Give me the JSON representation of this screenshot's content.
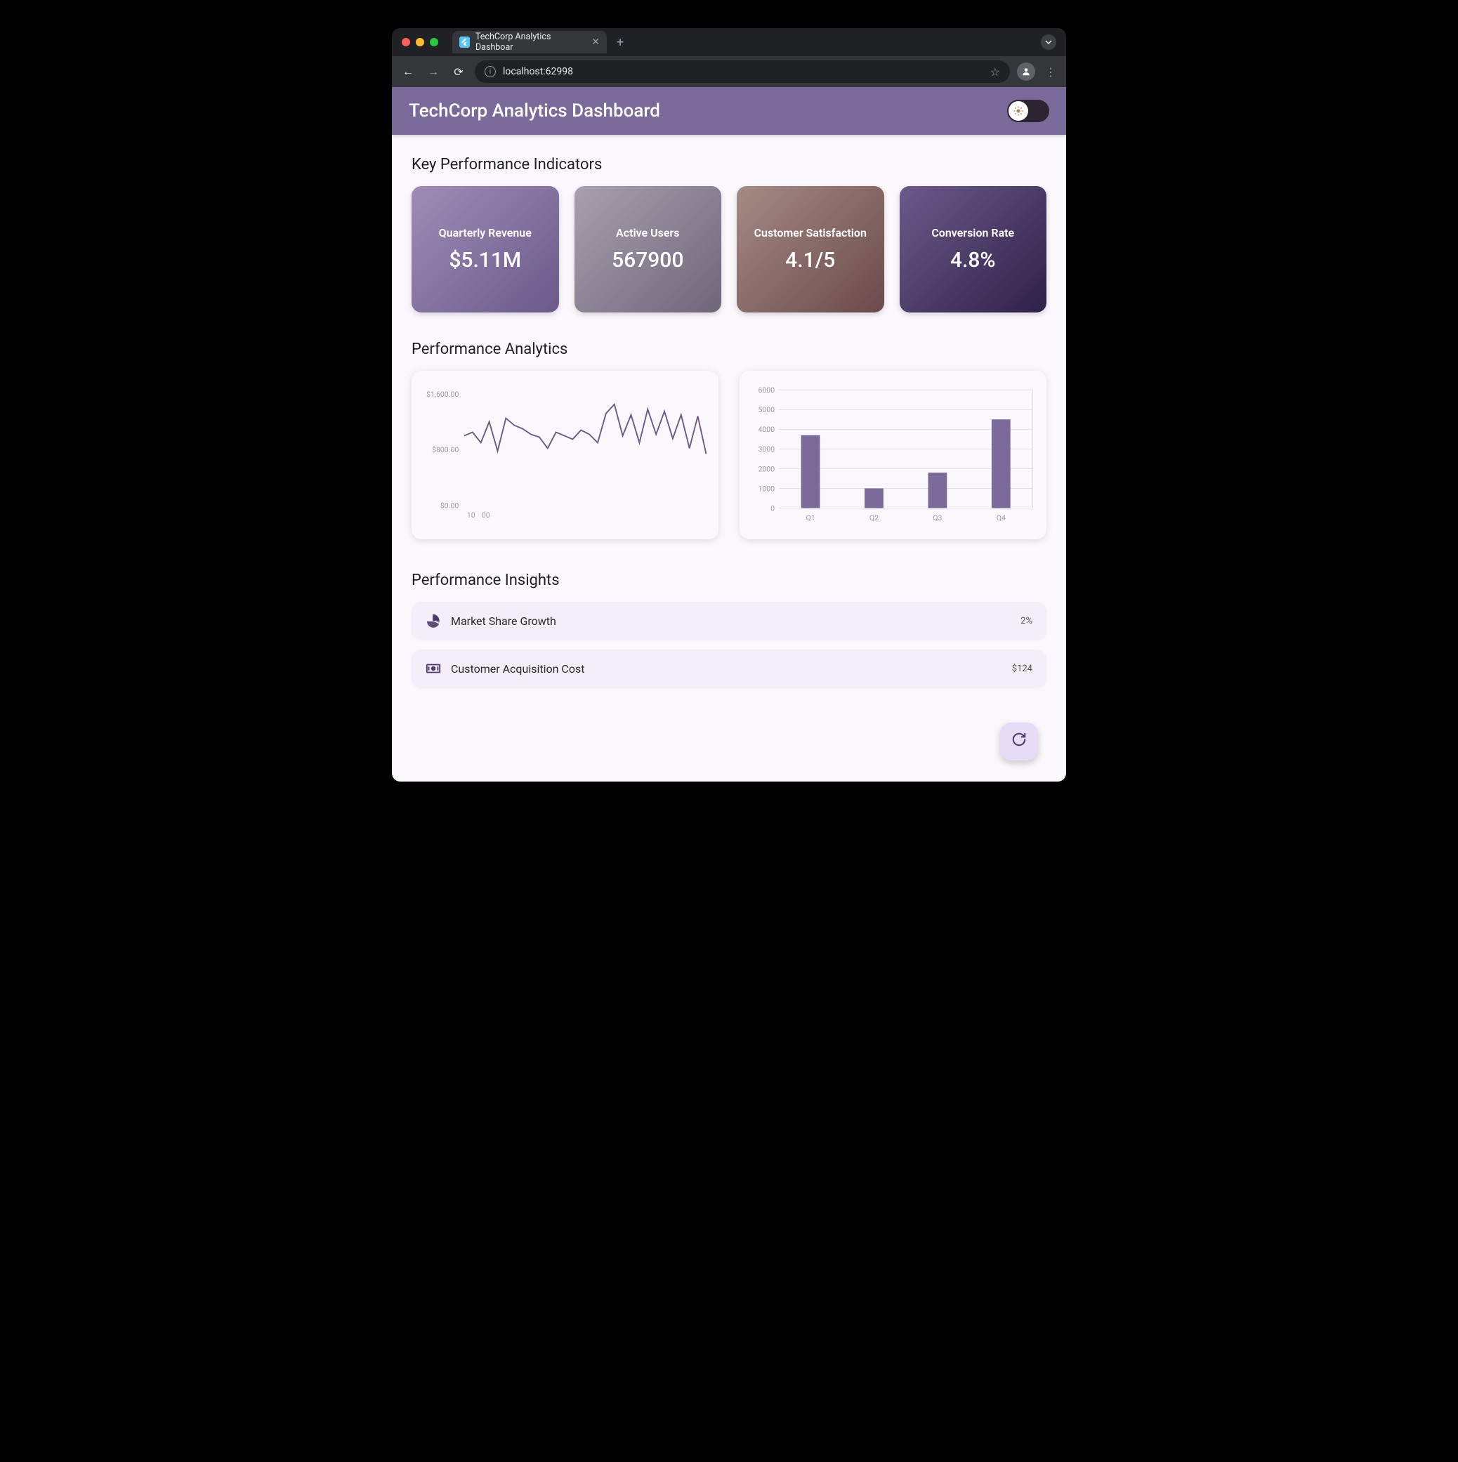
{
  "browser": {
    "tab_title": "TechCorp Analytics Dashboar",
    "url": "localhost:62998"
  },
  "app": {
    "title": "TechCorp Analytics Dashboard"
  },
  "sections": {
    "kpi_title": "Key Performance Indicators",
    "analytics_title": "Performance Analytics",
    "insights_title": "Performance Insights"
  },
  "kpi": [
    {
      "label": "Quarterly Revenue",
      "value": "$5.11M"
    },
    {
      "label": "Active Users",
      "value": "567900"
    },
    {
      "label": "Customer Satisfaction",
      "value": "4.1/5"
    },
    {
      "label": "Conversion Rate",
      "value": "4.8%"
    }
  ],
  "insights": [
    {
      "icon": "pie",
      "label": "Market Share Growth",
      "value": "2%"
    },
    {
      "icon": "bill",
      "label": "Customer Acquisition Cost",
      "value": "$124"
    }
  ],
  "chart_data": [
    {
      "type": "line",
      "title": "",
      "xlabel": "",
      "ylabel": "",
      "y_ticks": [
        "$0.00",
        "$800.00",
        "$1,600.00"
      ],
      "x_ticks": [
        "10",
        "00"
      ],
      "ylim": [
        0,
        1600
      ],
      "x": [
        1,
        2,
        3,
        4,
        5,
        6,
        7,
        8,
        9,
        10,
        11,
        12,
        13,
        14,
        15,
        16,
        17,
        18,
        19,
        20,
        21,
        22,
        23,
        24,
        25,
        26,
        27,
        28,
        29,
        30
      ],
      "values": [
        1000,
        1050,
        900,
        1200,
        780,
        1250,
        1150,
        1100,
        1020,
        980,
        820,
        1050,
        1000,
        950,
        1080,
        1020,
        900,
        1320,
        1450,
        1000,
        1300,
        900,
        1380,
        1020,
        1350,
        960,
        1300,
        820,
        1280,
        740
      ]
    },
    {
      "type": "bar",
      "title": "",
      "xlabel": "",
      "ylabel": "",
      "y_ticks": [
        0,
        1000,
        2000,
        3000,
        4000,
        5000,
        6000
      ],
      "ylim": [
        0,
        6000
      ],
      "categories": [
        "Q1",
        "Q2",
        "Q3",
        "Q4"
      ],
      "values": [
        3700,
        1000,
        1800,
        4500
      ]
    }
  ]
}
